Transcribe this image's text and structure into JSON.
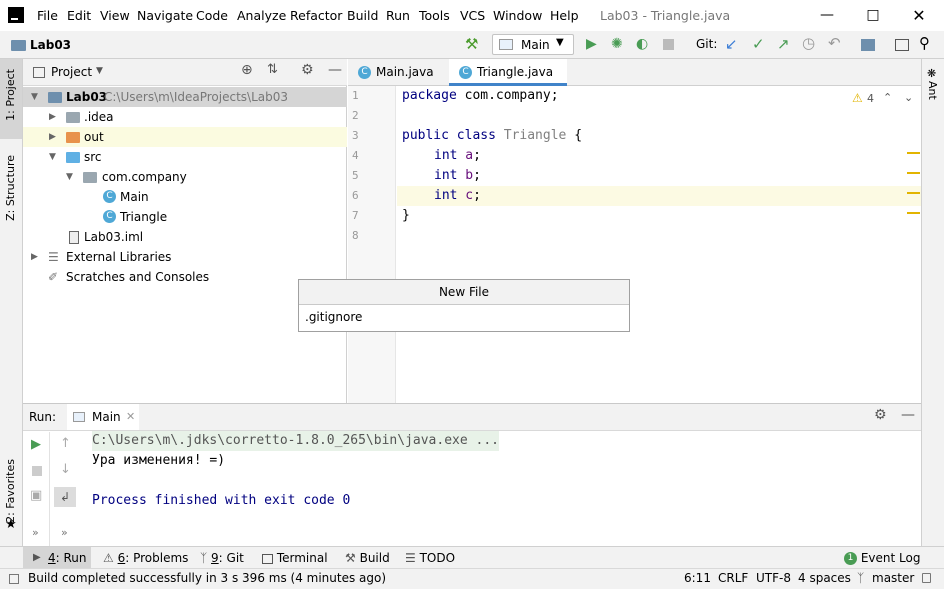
{
  "menu": [
    "File",
    "Edit",
    "View",
    "Navigate",
    "Code",
    "Analyze",
    "Refactor",
    "Build",
    "Run",
    "Tools",
    "VCS",
    "Window",
    "Help"
  ],
  "window_title": "Lab03 - Triangle.java",
  "breadcrumb": "Lab03",
  "run_config": "Main",
  "git_label": "Git:",
  "project_panel": {
    "title": "Project",
    "tree": [
      {
        "label": "Lab03",
        "path": "C:\\Users\\m\\IdeaProjects\\Lab03",
        "bold": true
      },
      {
        "label": ".idea"
      },
      {
        "label": "out"
      },
      {
        "label": "src"
      },
      {
        "label": "com.company"
      },
      {
        "label": "Main"
      },
      {
        "label": "Triangle"
      },
      {
        "label": "Lab03.iml"
      },
      {
        "label": "External Libraries"
      },
      {
        "label": "Scratches and Consoles"
      }
    ]
  },
  "left_stripe": {
    "project": "1: Project",
    "structure": "Z: Structure",
    "favorites": "2: Favorites"
  },
  "right_stripe": {
    "ant": "Ant"
  },
  "editor": {
    "tabs": [
      {
        "label": "Main.java"
      },
      {
        "label": "Triangle.java",
        "active": true
      }
    ],
    "line_numbers": [
      "1",
      "2",
      "3",
      "4",
      "5",
      "6",
      "7",
      "8"
    ],
    "code": {
      "l1_kw": "package",
      "l1_rest": " com.company;",
      "l3_kw": "public class",
      "l3_name": " Triangle",
      "l3_rest": " {",
      "type": "int",
      "f_a": " a",
      "f_b": " b",
      "f_c": " c",
      "semi": ";",
      "close": "}"
    },
    "warnings": "4"
  },
  "popup": {
    "title": "New File",
    "item": ".gitignore"
  },
  "run_panel": {
    "label": "Run:",
    "tab": "Main",
    "console": [
      "C:\\Users\\m\\.jdks\\corretto-1.8.0_265\\bin\\java.exe ...",
      "Ура изменения! =)",
      "",
      "Process finished with exit code 0"
    ]
  },
  "tool_tabs": [
    {
      "num": "4",
      "label": ": Run"
    },
    {
      "num": "6",
      "label": ": Problems"
    },
    {
      "num": "9",
      "label": ": Git"
    },
    {
      "num": "",
      "label": "Terminal"
    },
    {
      "num": "",
      "label": "Build"
    },
    {
      "num": "",
      "label": "TODO"
    }
  ],
  "event_log": {
    "count": "1",
    "label": "Event Log"
  },
  "status": {
    "message": "Build completed successfully in 3 s 396 ms (4 minutes ago)",
    "position": "6:11",
    "line_sep": "CRLF",
    "encoding": "UTF-8",
    "indent": "4 spaces",
    "branch": "master"
  }
}
